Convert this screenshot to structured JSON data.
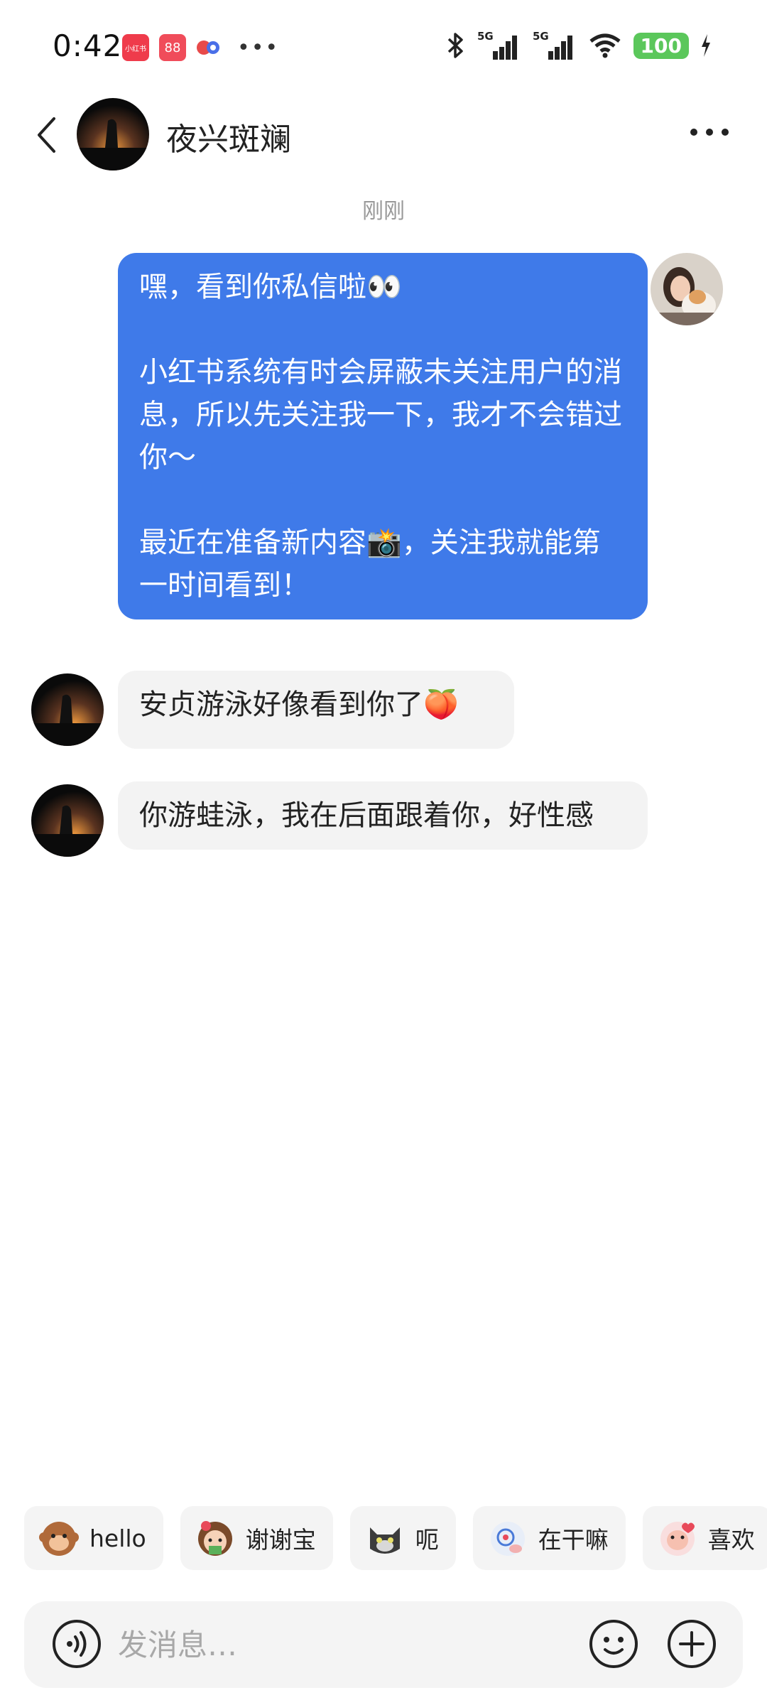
{
  "status_bar": {
    "time": "0:42",
    "battery": "100",
    "app_badges": [
      "小红书",
      "88"
    ],
    "network": [
      "5G",
      "5G"
    ]
  },
  "header": {
    "contact_name": "夜兴斑斓"
  },
  "timestamp": "刚刚",
  "messages": {
    "outgoing": {
      "para1": "嘿，看到你私信啦👀",
      "para2": "小红书系统有时会屏蔽未关注用户的消息，所以先关注我一下，我才不会错过你～",
      "para3": "最近在准备新内容📸，关注我就能第一时间看到！"
    },
    "incoming1": "安贞游泳好像看到你了🍑",
    "incoming2": "你游蛙泳，我在后面跟着你，好性感"
  },
  "quick_replies": [
    {
      "label": "hello",
      "icon": "monkey-emoji-icon"
    },
    {
      "label": "谢谢宝",
      "icon": "girl-flower-emoji-icon"
    },
    {
      "label": "呃",
      "icon": "cat-emoji-icon"
    },
    {
      "label": "在干嘛",
      "icon": "peek-emoji-icon"
    },
    {
      "label": "喜欢",
      "icon": "love-emoji-icon"
    }
  ],
  "input": {
    "placeholder": "发消息…"
  },
  "colors": {
    "outgoing_bubble": "#3f7ae9",
    "incoming_bubble": "#f3f3f3",
    "battery": "#5bc75b"
  }
}
